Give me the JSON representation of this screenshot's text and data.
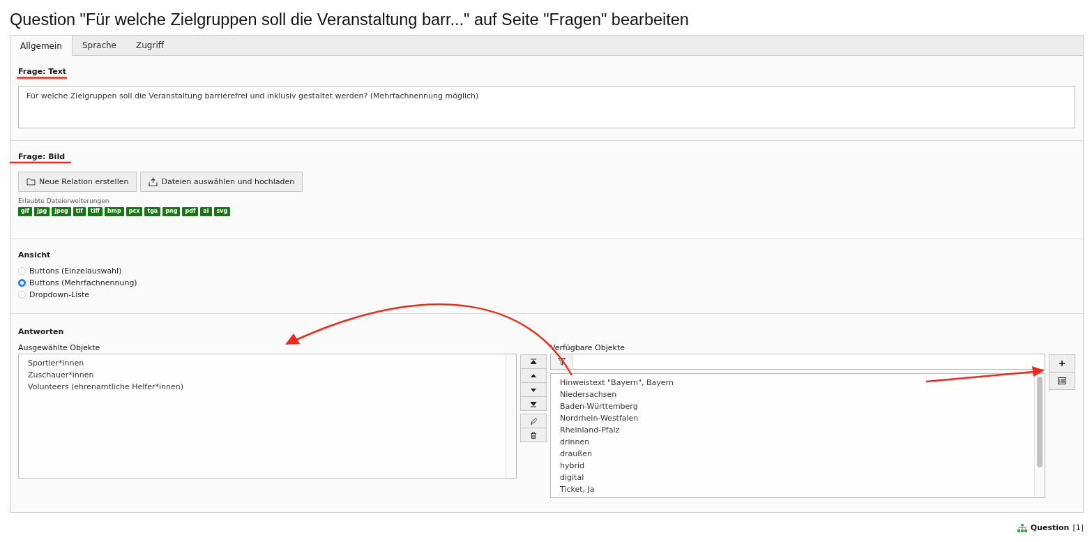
{
  "page_title": "Question \"Für welche Zielgruppen soll die Veranstaltung barr...\" auf Seite \"Fragen\" bearbeiten",
  "tabs": [
    {
      "label": "Allgemein",
      "selected": true
    },
    {
      "label": "Sprache",
      "selected": false
    },
    {
      "label": "Zugriff",
      "selected": false
    }
  ],
  "sections": [
    {
      "kind": "text",
      "label": "Frage: Text",
      "value": "Für welche Zielgruppen soll die Veranstaltung barrierefrei und inklusiv gestaltet werden? (Mehrfachnennung möglich)"
    },
    {
      "kind": "file",
      "label": "Frage: Bild",
      "buttons": [
        "Neue Relation erstellen",
        "Dateien auswählen und hochladen"
      ],
      "extensions_label": "Erlaubte Dateierweiterungen",
      "extensions": [
        "gif",
        "jpg",
        "jpeg",
        "tif",
        "tiff",
        "bmp",
        "pcx",
        "tga",
        "png",
        "pdf",
        "ai",
        "svg"
      ]
    },
    {
      "kind": "radio",
      "label": "Ansicht",
      "options": [
        {
          "label": "Buttons (Einzelauswahl)",
          "selected": false
        },
        {
          "label": "Buttons (Mehrfachnennung)",
          "selected": true
        },
        {
          "label": "Dropdown-Liste",
          "selected": false
        }
      ]
    },
    {
      "kind": "selector",
      "label": "Antworten",
      "selected_label": "Ausgewählte Objekte",
      "selected_items": [
        "Sportler*innen",
        "Zuschauer*innen",
        "Volunteers (ehrenamtliche Helfer*innen)"
      ],
      "available_label": "Verfügbare Objekte",
      "available_items": [
        "Hinweistext \"Bayern\", Bayern",
        "Niedersachsen",
        "Baden-Württemberg",
        "Nordrhein-Westfalen",
        "Rheinland-Pfalz",
        "drinnen",
        "draußen",
        "hybrid",
        "digital",
        "Ticket, Ja"
      ]
    }
  ],
  "footer": {
    "record_type": "Question",
    "count": "[1]"
  }
}
